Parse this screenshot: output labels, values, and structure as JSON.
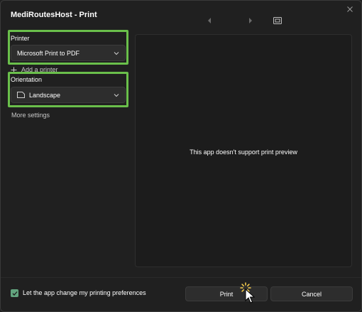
{
  "window": {
    "title": "MediRoutesHost - Print"
  },
  "printer": {
    "label": "Printer",
    "selected": "Microsoft Print to PDF",
    "add_printer_label": "Add a printer"
  },
  "orientation": {
    "label": "Orientation",
    "selected": "Landscape"
  },
  "more_settings_label": "More settings",
  "preview": {
    "message": "This app doesn't support print preview"
  },
  "footer": {
    "checkbox_label": "Let the app change my printing preferences",
    "checkbox_checked": true,
    "print_label": "Print",
    "cancel_label": "Cancel"
  },
  "colors": {
    "background": "#202020",
    "highlight": "#6abf4b",
    "checkbox_accent": "#63a47f",
    "spinner": "#f2c94c"
  },
  "icons": [
    "close-icon",
    "chevron-left-icon",
    "chevron-right-icon",
    "fit-to-page-icon",
    "chevron-down-icon",
    "plus-icon",
    "landscape-page-icon",
    "checkmark-icon",
    "loading-spinner-icon",
    "mouse-cursor-icon"
  ]
}
